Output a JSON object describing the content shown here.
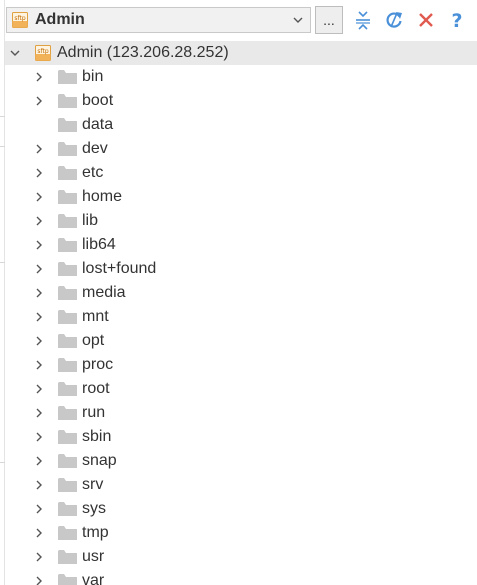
{
  "toolbar": {
    "site_name": "Admin",
    "more_label": "...",
    "icons": {
      "site": "sftp-icon",
      "dropdown": "chevron-down-icon",
      "collapse": "collapse-all-icon",
      "refresh": "refresh-icon",
      "disconnect": "close-icon",
      "help": "help-icon"
    }
  },
  "tree": {
    "root_label": "Admin (123.206.28.252)",
    "items": [
      {
        "name": "bin",
        "expandable": true
      },
      {
        "name": "boot",
        "expandable": true
      },
      {
        "name": "data",
        "expandable": false
      },
      {
        "name": "dev",
        "expandable": true
      },
      {
        "name": "etc",
        "expandable": true
      },
      {
        "name": "home",
        "expandable": true
      },
      {
        "name": "lib",
        "expandable": true
      },
      {
        "name": "lib64",
        "expandable": true
      },
      {
        "name": "lost+found",
        "expandable": true
      },
      {
        "name": "media",
        "expandable": true
      },
      {
        "name": "mnt",
        "expandable": true
      },
      {
        "name": "opt",
        "expandable": true
      },
      {
        "name": "proc",
        "expandable": true
      },
      {
        "name": "root",
        "expandable": true
      },
      {
        "name": "run",
        "expandable": true
      },
      {
        "name": "sbin",
        "expandable": true
      },
      {
        "name": "snap",
        "expandable": true
      },
      {
        "name": "srv",
        "expandable": true
      },
      {
        "name": "sys",
        "expandable": true
      },
      {
        "name": "tmp",
        "expandable": true
      },
      {
        "name": "usr",
        "expandable": true
      },
      {
        "name": "var",
        "expandable": true
      }
    ]
  },
  "colors": {
    "accent_blue": "#4a90d9",
    "disconnect_red": "#e05a4f",
    "folder_gray": "#c8c8c8",
    "selected_row": "#e9e9e9"
  }
}
